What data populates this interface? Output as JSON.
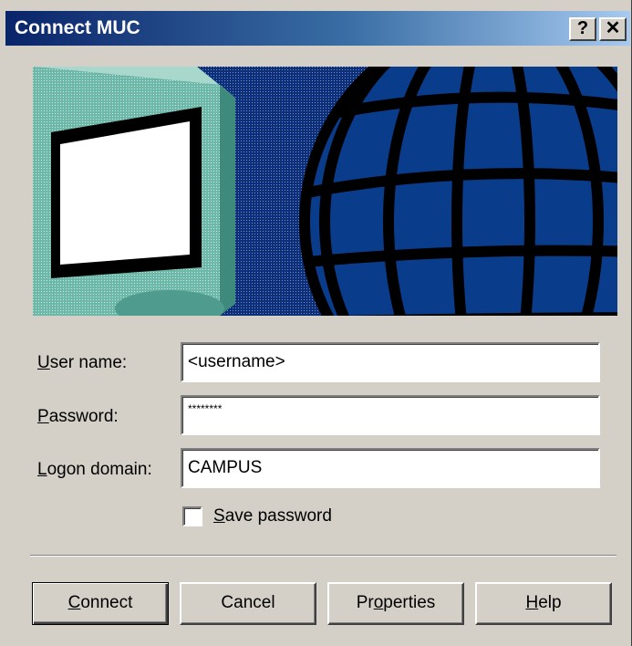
{
  "window": {
    "title": "Connect MUC",
    "help_glyph": "?",
    "close_glyph": "✕"
  },
  "banner": {
    "icons": [
      "computer-monitor-icon",
      "globe-icon"
    ]
  },
  "form": {
    "username_label_accel": "U",
    "username_label_rest": "ser name:",
    "username_value": "<username>",
    "password_label_accel": "P",
    "password_label_rest": "assword:",
    "password_value": "********",
    "domain_label_accel": "L",
    "domain_label_rest": "ogon domain:",
    "domain_value": "CAMPUS",
    "save_password_accel": "S",
    "save_password_rest": "ave password",
    "save_password_checked": false
  },
  "buttons": {
    "connect_accel": "C",
    "connect_rest": "onnect",
    "cancel": "Cancel",
    "properties_pre": "Pr",
    "properties_accel": "o",
    "properties_rest": "perties",
    "help_accel": "H",
    "help_rest": "elp"
  },
  "colors": {
    "titlebar_start": "#0a246a",
    "titlebar_end": "#a6caf0",
    "dialog_bg": "#d4d0c8",
    "banner_blue": "#0a3c8c",
    "monitor_teal": "#7ec8b8"
  }
}
